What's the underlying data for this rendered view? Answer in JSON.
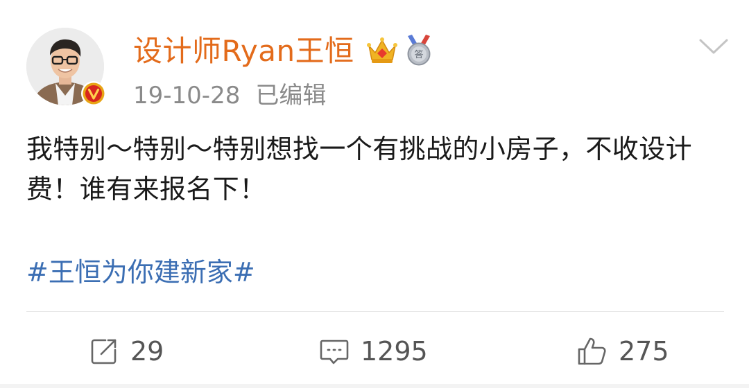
{
  "post": {
    "author": "设计师Ryan王恒",
    "date": "19-10-28",
    "edited_label": "已编辑",
    "text": "我特别～特别～特别想找一个有挑战的小房子，不收设计费！谁有来报名下！",
    "topic": "#王恒为你建新家#"
  },
  "actions": {
    "repost_count": "29",
    "comment_count": "1295",
    "like_count": "275"
  },
  "icons": {
    "crown": "crown-icon",
    "medal": "medal-icon",
    "verified": "verified-badge-icon",
    "chevron": "chevron-down-icon",
    "repost": "repost-icon",
    "comment": "comment-icon",
    "like": "thumbs-up-icon"
  },
  "colors": {
    "author_name": "#e36b1b",
    "topic_link": "#3b6eb3",
    "meta_text": "#8a8a8a",
    "verified_badge": "#e8a415"
  }
}
